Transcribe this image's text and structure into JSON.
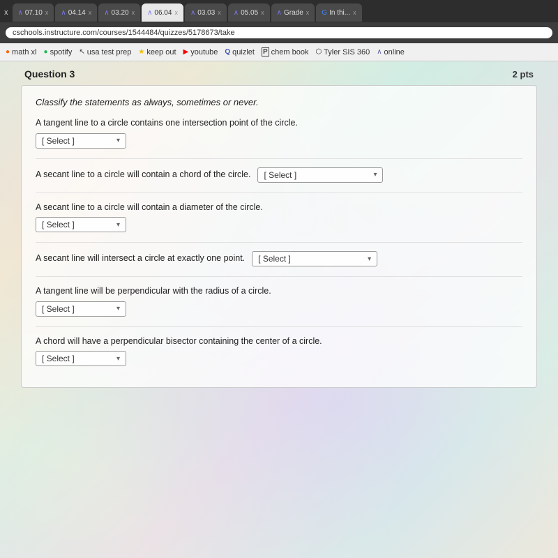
{
  "browser": {
    "tabs": [
      {
        "label": "07.10",
        "active": false,
        "icon": "∧"
      },
      {
        "label": "04.14",
        "active": false,
        "icon": "∧"
      },
      {
        "label": "03.20",
        "active": false,
        "icon": "∧"
      },
      {
        "label": "06.04",
        "active": false,
        "icon": "∧"
      },
      {
        "label": "03.03",
        "active": false,
        "icon": "∧"
      },
      {
        "label": "05.05",
        "active": false,
        "icon": "∧"
      },
      {
        "label": "Grade",
        "active": false,
        "icon": "∧"
      },
      {
        "label": "In thi...",
        "active": false,
        "icon": "G"
      }
    ],
    "address": "cschools.instructure.com/courses/1544484/quizzes/5178673/take",
    "bookmarks": [
      {
        "label": "math xl",
        "color": "#ff6600"
      },
      {
        "label": "spotify",
        "color": "#1db954"
      },
      {
        "label": "usa test prep",
        "icon": "cursor"
      },
      {
        "label": "keep out",
        "icon": "star"
      },
      {
        "label": "youtube",
        "color": "#ff0000"
      },
      {
        "label": "quizlet",
        "color": "#4257b2"
      },
      {
        "label": "chem book",
        "color": "#444"
      },
      {
        "label": "Tyler SIS 360"
      },
      {
        "label": "online"
      }
    ]
  },
  "quiz": {
    "question_title": "Question 3",
    "points": "2 pts",
    "instruction": "Classify the statements as always, sometimes or never.",
    "statements": [
      {
        "id": 1,
        "text": "A tangent line to a circle contains one intersection point of the circle.",
        "inline": false,
        "select_label": "[ Select ]"
      },
      {
        "id": 2,
        "text": "A secant line to a circle will contain a chord of the circle.",
        "inline": true,
        "select_label": "[ Select ]"
      },
      {
        "id": 3,
        "text": "A secant line to a circle will contain a diameter of the circle.",
        "inline": false,
        "select_label": "[ Select ]"
      },
      {
        "id": 4,
        "text": "A secant line will intersect a circle at exactly one point.",
        "inline": true,
        "select_label": "[ Select ]"
      },
      {
        "id": 5,
        "text": "A tangent line will be perpendicular with the radius of a circle.",
        "inline": false,
        "select_label": "[ Select ]"
      },
      {
        "id": 6,
        "text": "A chord will have a perpendicular bisector containing the center of a circle.",
        "inline": false,
        "select_label": "[ Select ]"
      }
    ]
  }
}
